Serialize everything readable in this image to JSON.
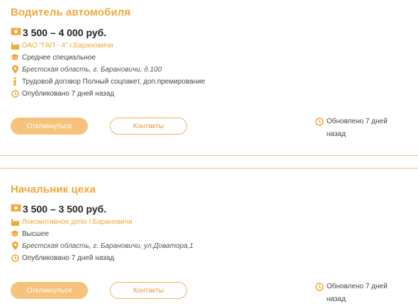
{
  "colors": {
    "accent": "#f0a83a",
    "button_fill": "#f7c27c"
  },
  "vacancies": [
    {
      "title": "Водитель автомобиля",
      "salary": "3 500 – 4 000 руб.",
      "company": "ОАО \"ГАП - 4\" г.Барановичи",
      "education": "Среднее специальное",
      "address": "Брестская область, г. Барановичи, д.100",
      "conditions": "Трудовой договор Полный соцпакет, доп.премирование",
      "published": "Опубликовано 7 дней назад",
      "respond_label": "Откликнуться",
      "contacts_label": "Контакты",
      "updated": "Обновлено 7 дней назад"
    },
    {
      "title": "Начальник цеха",
      "salary": "3 500 – 3 500 руб.",
      "company": "Локомотивное депо г.Барановичи",
      "education": "Высшее",
      "address": "Брестская область, г. Барановичи, ул.Доватора,1",
      "published": "Опубликовано 7 дней назад",
      "respond_label": "Откликнуться",
      "contacts_label": "Контакты",
      "updated": "Обновлено 7 дней назад"
    }
  ],
  "icons": [
    "money-icon",
    "factory-icon",
    "graduation-cap-icon",
    "location-pin-icon",
    "info-icon",
    "clock-icon"
  ]
}
